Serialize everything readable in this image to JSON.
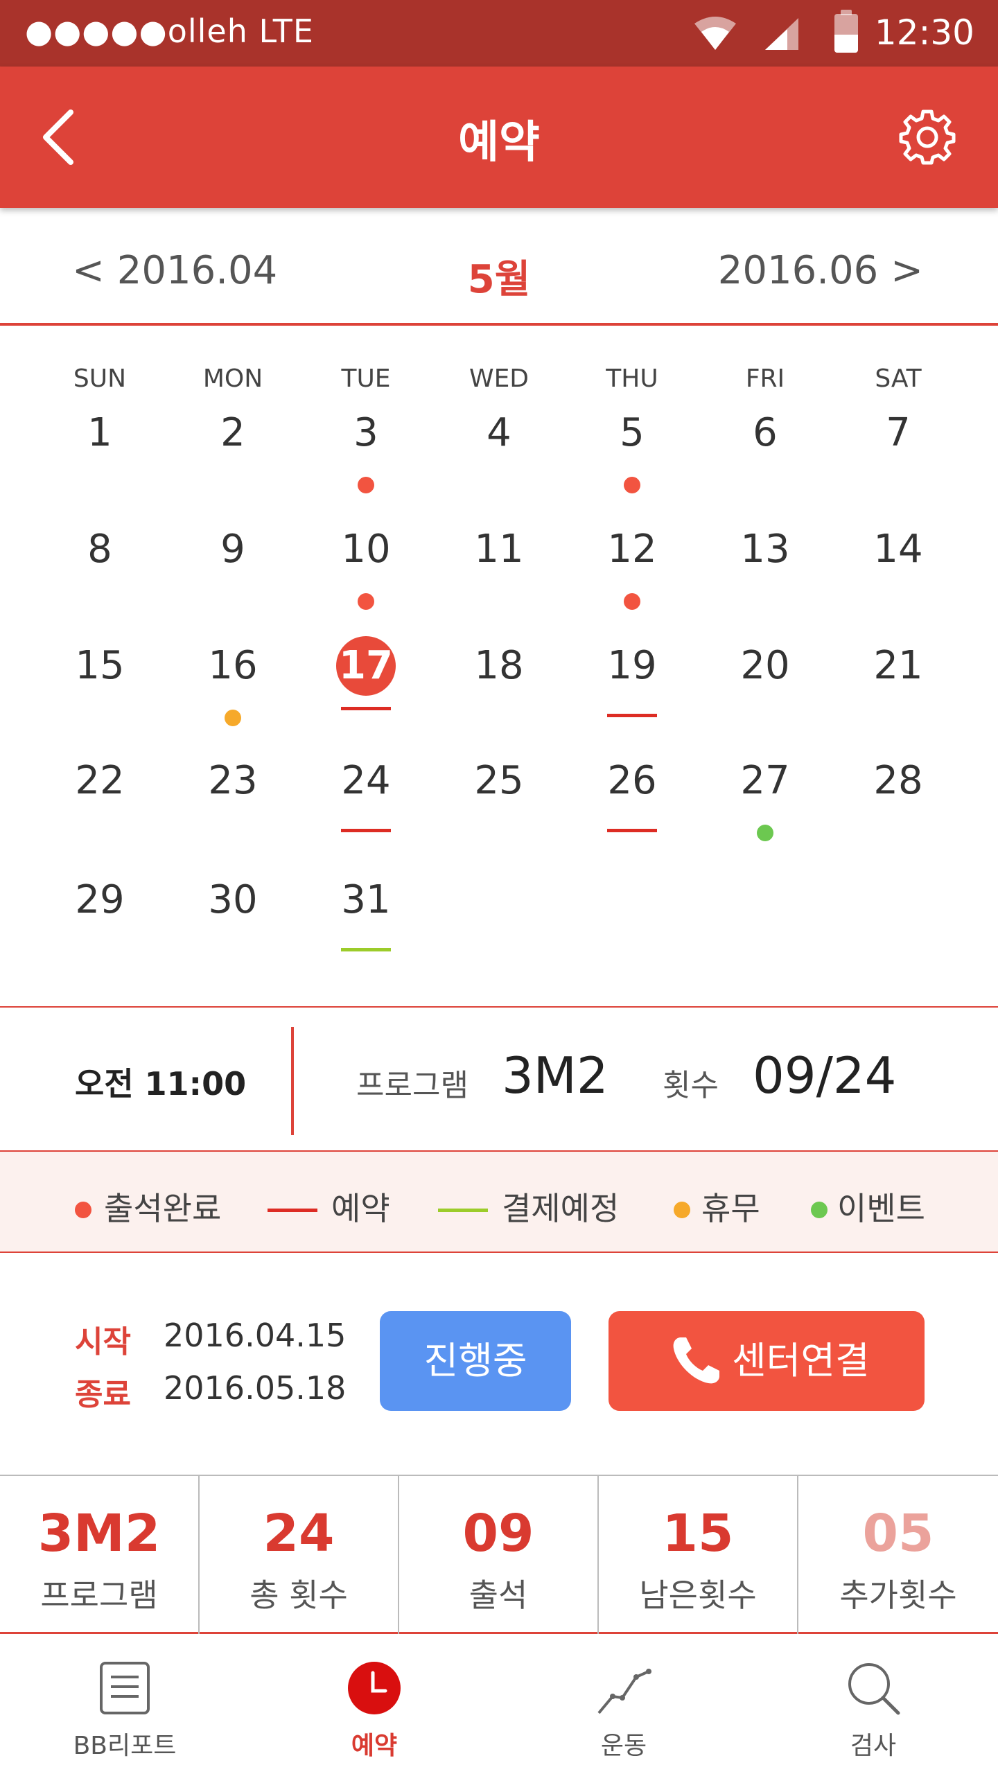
{
  "status_bar": {
    "carrier": "●●●●●olleh  LTE",
    "time": "12:30",
    "icons": [
      "wifi-icon",
      "signal-icon",
      "battery-icon"
    ]
  },
  "app_bar": {
    "title": "예약",
    "back_icon": "chevron-left-icon",
    "settings_icon": "gear-icon"
  },
  "month_nav": {
    "prev": "< 2016.04",
    "current": "5월",
    "next": "2016.06 >"
  },
  "calendar": {
    "weekdays": [
      "SUN",
      "MON",
      "TUE",
      "WED",
      "THU",
      "FRI",
      "SAT"
    ],
    "first_weekday_index": 0,
    "days_in_month": 31,
    "today": 17,
    "markers": {
      "3": "attended",
      "5": "attended",
      "10": "attended",
      "12": "attended",
      "16": "holiday",
      "19": "reserved",
      "24": "reserved",
      "26": "reserved",
      "27": "event",
      "31": "payment",
      "17": "reserved"
    },
    "marker_colors": {
      "attended": "#f25440",
      "reserved": "#dd2c24",
      "payment": "#9ccc2a",
      "holiday": "#f6a92a",
      "event": "#6cc850"
    }
  },
  "class_info": {
    "time": "오전 11:00",
    "program_label": "프로그램",
    "program_value": "3M2",
    "count_label": "횟수",
    "count_value": "09/24"
  },
  "legend": {
    "attended": "출석완료",
    "reserved": "예약",
    "payment": "결제예정",
    "holiday": "휴무",
    "event": "이벤트"
  },
  "period": {
    "start_label": "시작",
    "start_date": "2016.04.15",
    "end_label": "종료",
    "end_date": "2016.05.18",
    "status_button": "진행중",
    "call_button": "센터연결"
  },
  "stats": [
    {
      "value": "3M2",
      "label": "프로그램",
      "color": "#d93a30"
    },
    {
      "value": "24",
      "label": "총 횟수",
      "color": "#d93a30"
    },
    {
      "value": "09",
      "label": "출석",
      "color": "#d93a30"
    },
    {
      "value": "15",
      "label": "남은횟수",
      "color": "#d93a30"
    },
    {
      "value": "05",
      "label": "추가횟수",
      "color": "#eba29b"
    }
  ],
  "bottom_nav": [
    {
      "label": "BB리포트",
      "icon": "report-icon",
      "active": false
    },
    {
      "label": "예약",
      "icon": "clock-icon",
      "active": true
    },
    {
      "label": "운동",
      "icon": "chart-line-icon",
      "active": false
    },
    {
      "label": "검사",
      "icon": "search-icon",
      "active": false
    }
  ]
}
